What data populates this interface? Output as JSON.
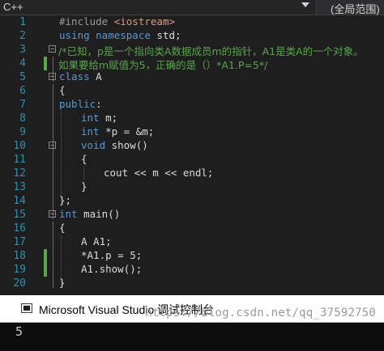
{
  "toolbar": {
    "language": "C++",
    "scope": "(全局范围)"
  },
  "editor": {
    "lines": [
      {
        "n": "1"
      },
      {
        "n": "2"
      },
      {
        "n": "3"
      },
      {
        "n": "4"
      },
      {
        "n": "5"
      },
      {
        "n": "6"
      },
      {
        "n": "7"
      },
      {
        "n": "8"
      },
      {
        "n": "9"
      },
      {
        "n": "10"
      },
      {
        "n": "11"
      },
      {
        "n": "12"
      },
      {
        "n": "13"
      },
      {
        "n": "14"
      },
      {
        "n": "15"
      },
      {
        "n": "16"
      },
      {
        "n": "17"
      },
      {
        "n": "18"
      },
      {
        "n": "19"
      },
      {
        "n": "20"
      }
    ],
    "code": {
      "l1_pp": "#include ",
      "l1_str": "<iostream>",
      "l2_kw": "using namespace",
      "l2_rest": " std;",
      "l3_cm": "/*已知，p是一个指向类A数据成员m的指针，A1是类A的一个对象。",
      "l4_cm": "如果要给m赋值为5，正确的是（）*A1.P=5*/",
      "l5_kw": "class",
      "l5_rest": " A",
      "l6": "{",
      "l7_kw": "public",
      "l7_rest": ":",
      "l8_kw": "int",
      "l8_rest": " m;",
      "l9_kw": "int",
      "l9_rest": " *p = &m;",
      "l10_kw": "void",
      "l10_rest": " show()",
      "l11": "{",
      "l12": "cout << m << endl;",
      "l13": "}",
      "l14": "};",
      "l15_kw": "int",
      "l15_rest": " main()",
      "l16": "{",
      "l17": "A A1;",
      "l18": "*A1.p = 5;",
      "l19": "A1.show();",
      "l20": "}"
    }
  },
  "console": {
    "title": "Microsoft Visual Studio 调试控制台",
    "output": "5",
    "watermark": "https://blog.csdn.net/qq_37592750"
  },
  "colors": {
    "background": "#1e1e1e",
    "keyword": "#569cd6",
    "comment": "#57a64a",
    "string": "#d69d85",
    "line_number": "#2b91af"
  }
}
